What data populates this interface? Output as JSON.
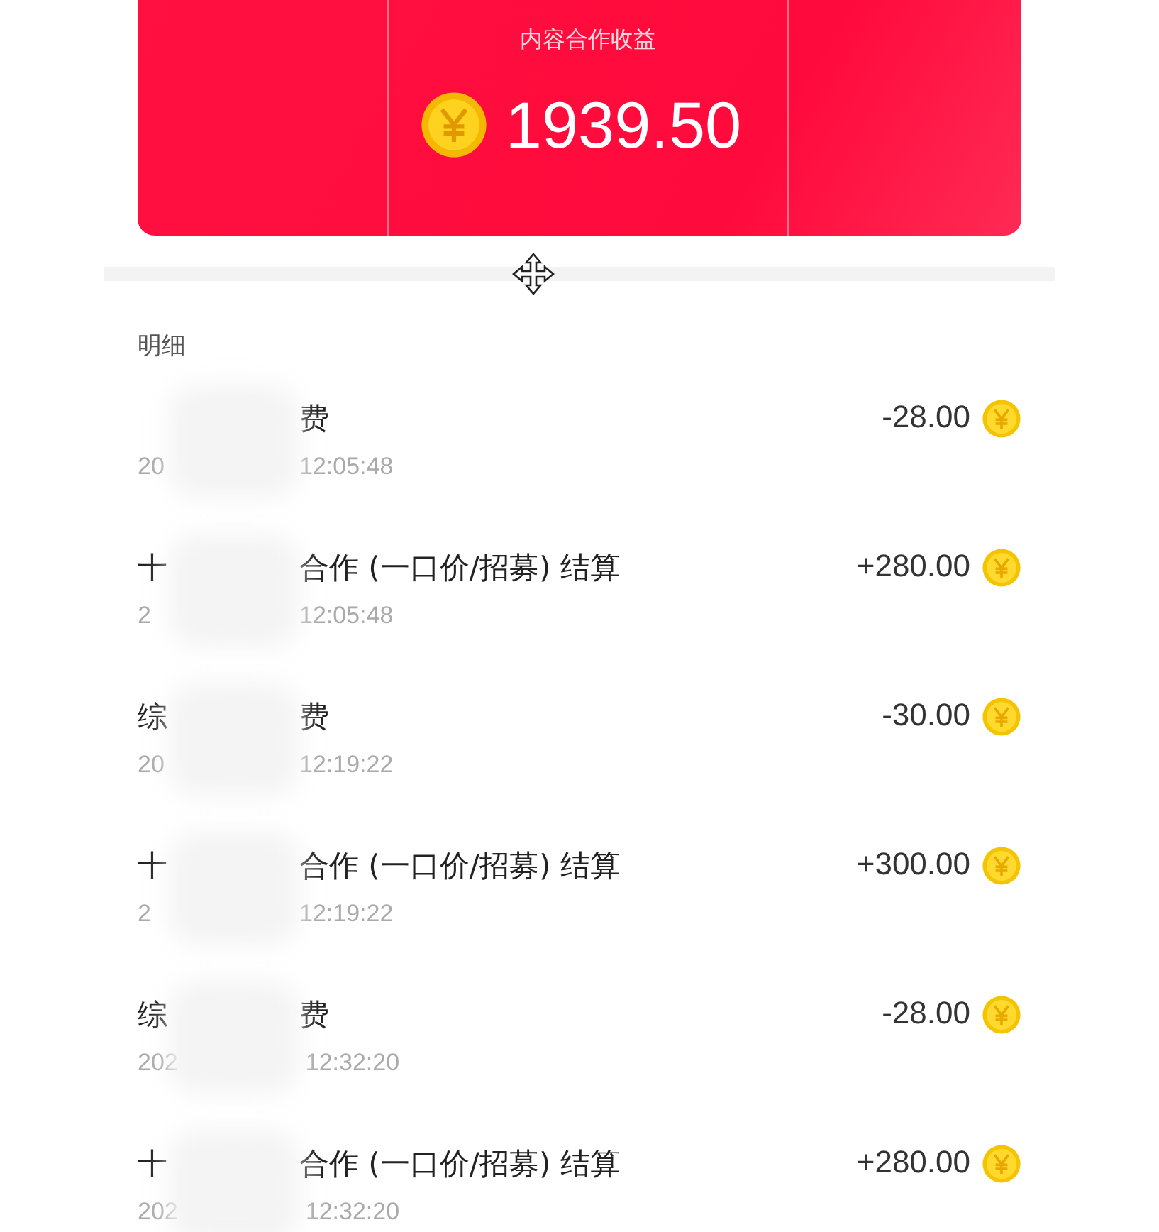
{
  "header_card": {
    "title": "内容合作收益",
    "amount": "1939.50"
  },
  "section_title": "明细",
  "rows": [
    {
      "title_end": "费",
      "time_start": "20",
      "time_end": "12:05:48",
      "amount": "-28.00"
    },
    {
      "title_start": "十",
      "title_end": "合作 (一口价/招募) 结算",
      "time_start": "2",
      "time_end": "12:05:48",
      "amount": "+280.00"
    },
    {
      "title_start": "综",
      "title_end": "费",
      "time_start": "20",
      "time_end": "12:19:22",
      "amount": "-30.00"
    },
    {
      "title_start": "十",
      "title_end": "合作 (一口价/招募) 结算",
      "time_start": "2",
      "time_end": "12:19:22",
      "amount": "+300.00"
    },
    {
      "title_start": "综",
      "title_end": "费",
      "time_start": "202",
      "time_end": "12:32:20",
      "amount": "-28.00"
    },
    {
      "title_start": "十",
      "title_end": "合作 (一口价/招募) 结算",
      "time_start": "202",
      "time_end": "12:32:20",
      "amount": "+280.00"
    }
  ]
}
